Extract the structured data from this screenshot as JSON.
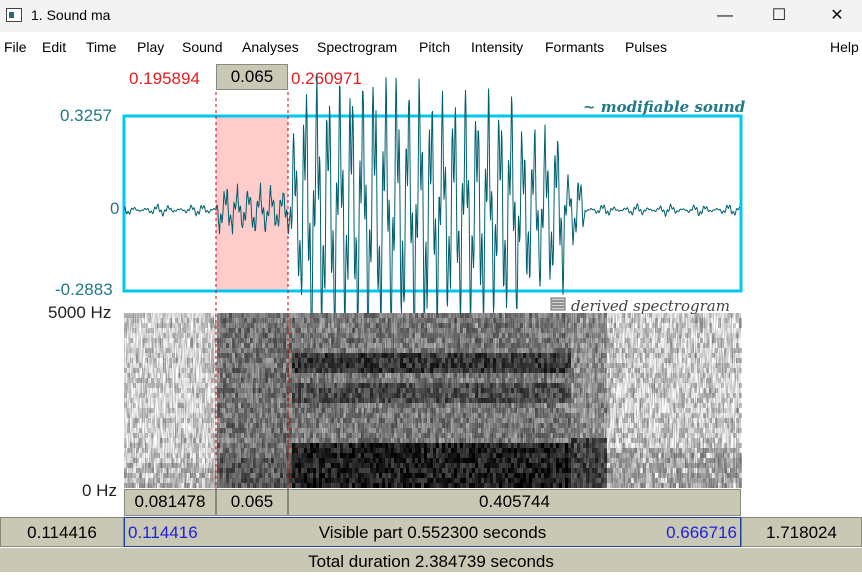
{
  "window": {
    "title": "1. Sound ma",
    "minimize_glyph": "—",
    "maximize_glyph": "☐",
    "close_glyph": "✕"
  },
  "menu": [
    "File",
    "Edit",
    "Time",
    "Play",
    "Sound",
    "Analyses",
    "Spectrogram",
    "Pitch",
    "Intensity",
    "Formants",
    "Pulses"
  ],
  "menu_help": "Help",
  "selection": {
    "start": "0.195894",
    "duration": "0.065",
    "end": "0.260971"
  },
  "waveform": {
    "label": "~ modifiable sound",
    "ymax": "0.3257",
    "yzero": "0",
    "ymin": "-0.2883",
    "color": "#006070"
  },
  "spectrogram": {
    "label": "derived spectrogram",
    "ymax": "5000 Hz",
    "ymin": "0 Hz"
  },
  "segments": {
    "before": "0.081478",
    "selection": "0.065",
    "after": "0.405744"
  },
  "status": {
    "window_start": "0.114416",
    "visible_start": "0.114416",
    "visible_label": "Visible part 0.552300 seconds",
    "visible_end": "0.666716",
    "window_end": "1.718024"
  },
  "total": "Total duration 2.384739 seconds",
  "colors": {
    "selection_fill": "#ffcccc",
    "frame": "#00c0f0",
    "cursor": "#cc0000",
    "bar_bg": "#c8c8b4",
    "blue_text": "#2020e0",
    "teal_text": "#217a86"
  }
}
